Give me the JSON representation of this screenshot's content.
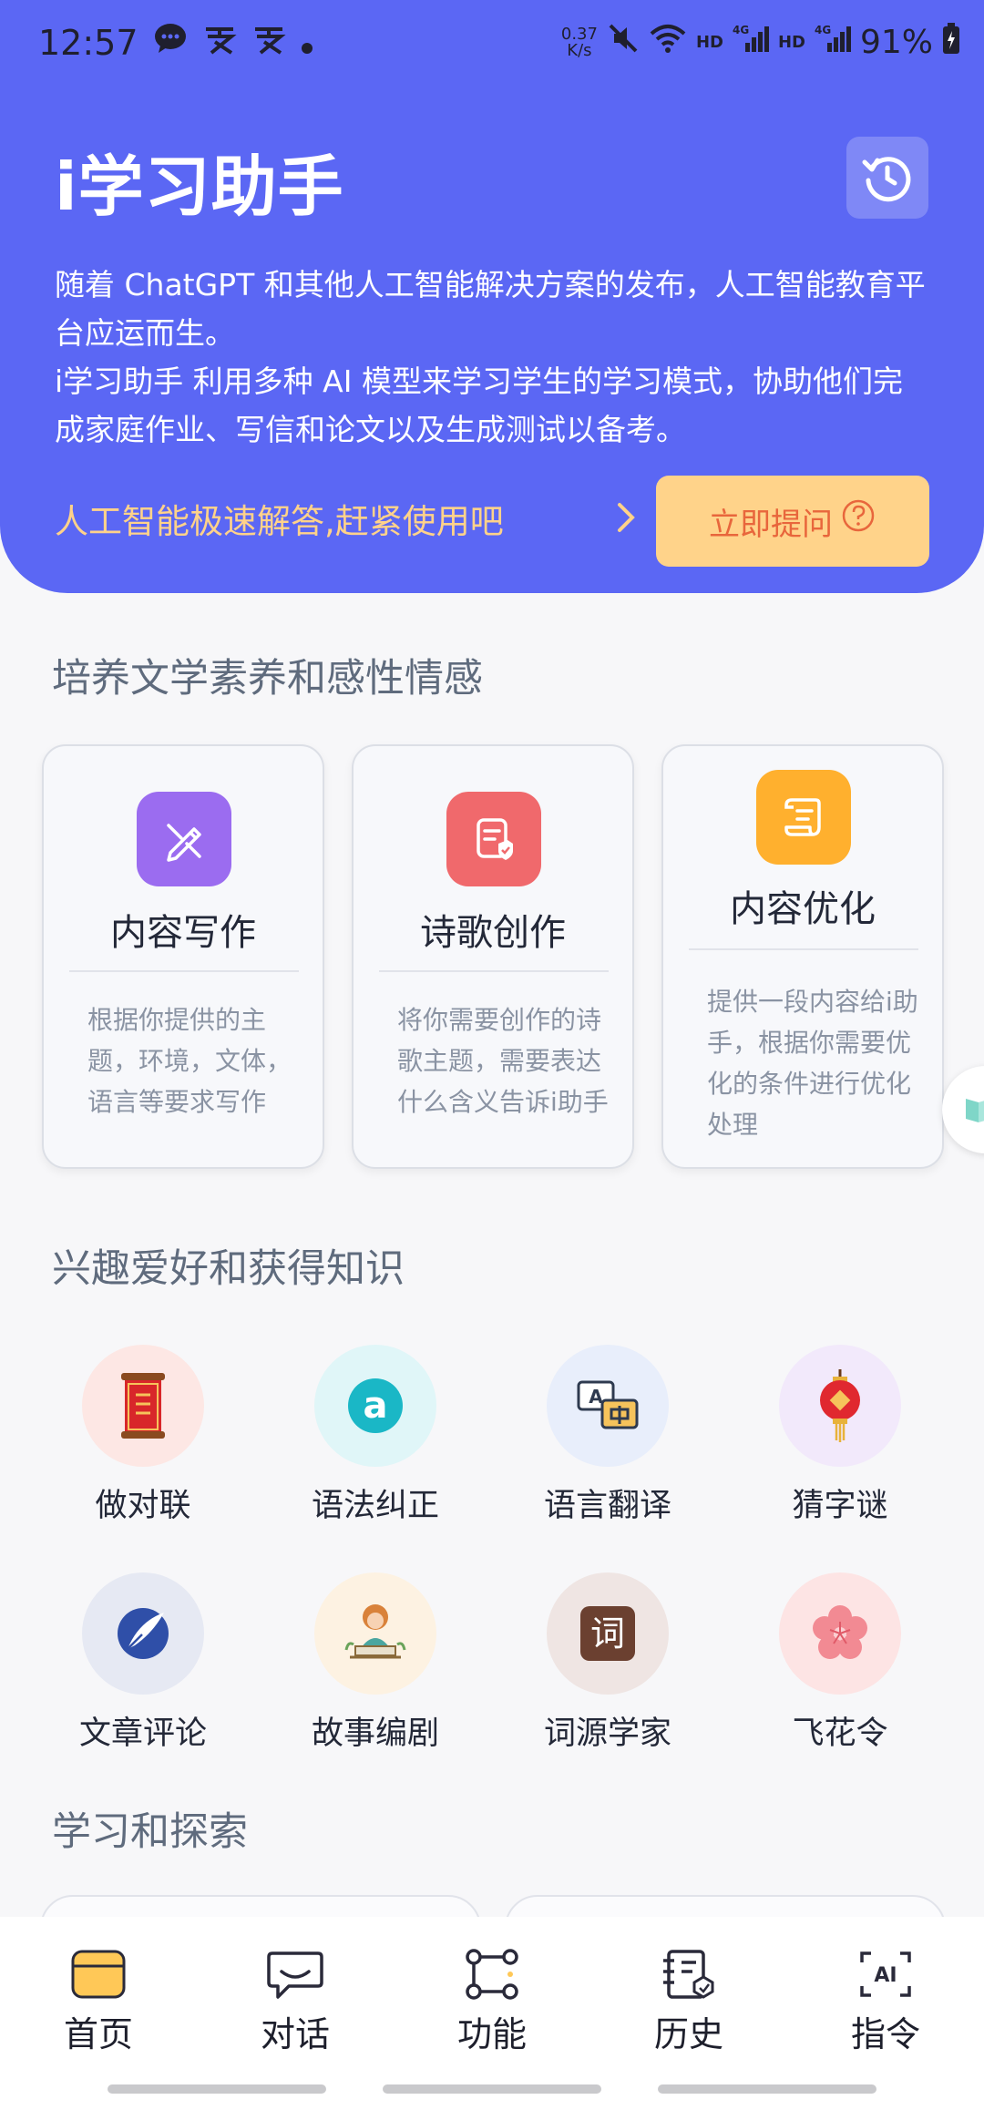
{
  "status_bar": {
    "time": "12:57",
    "net_speed_value": "0.37",
    "net_speed_unit": "K/s",
    "hd1": "HD",
    "hd2": "HD",
    "sig1": "4G",
    "sig2": "4G",
    "battery": "91%"
  },
  "header": {
    "title": "i学习助手",
    "intro_line1": "随着 ChatGPT 和其他人工智能解决方案的发布，人工智能教育平台应运而生。",
    "intro_line2": " i学习助手 利用多种 AI 模型来学习学生的学习模式，协助他们完成家庭作业、写信和论文以及生成测试以备考。",
    "cta_text": "人工智能极速解答,赶紧使用吧",
    "ask_button": "立即提问"
  },
  "section1": {
    "title": "培养文学素养和感性情感",
    "cards": [
      {
        "title": "内容写作",
        "desc": "根据你提供的主题，环境，文体，语言等要求写作",
        "icon": "pen-icon",
        "color": "#9b6cf0"
      },
      {
        "title": "诗歌创作",
        "desc": "将你需要创作的诗歌主题，需要表达什么含义告诉i助手",
        "icon": "poem-doc-icon",
        "color": "#f0696c"
      },
      {
        "title": "内容优化",
        "desc": "提供一段内容给i助手，根据你需要优化的条件进行优化处理",
        "icon": "scroll-icon",
        "color": "#ffb02e"
      }
    ]
  },
  "section2": {
    "title": "兴趣爱好和获得知识",
    "items": [
      {
        "label": "做对联",
        "icon": "couplet-scroll-icon",
        "bg": "#fde7e4"
      },
      {
        "label": "语法纠正",
        "icon": "grammar-a-icon",
        "bg": "#e0f6f8"
      },
      {
        "label": "语言翻译",
        "icon": "translate-icon",
        "bg": "#e8eefb"
      },
      {
        "label": "猜字谜",
        "icon": "lantern-icon",
        "bg": "#f2e9fb"
      },
      {
        "label": "文章评论",
        "icon": "quill-icon",
        "bg": "#e6e9f3"
      },
      {
        "label": "故事编剧",
        "icon": "storyteller-icon",
        "bg": "#fdf2e2"
      },
      {
        "label": "词源学家",
        "icon": "ci-char-icon",
        "bg": "#efe5e3"
      },
      {
        "label": "飞花令",
        "icon": "flower-icon",
        "bg": "#fde4e4"
      }
    ],
    "ci_char": "词"
  },
  "section3": {
    "title": "学习和探索"
  },
  "bottom_nav": [
    {
      "label": "首页",
      "icon": "home-icon"
    },
    {
      "label": "对话",
      "icon": "chat-icon"
    },
    {
      "label": "功能",
      "icon": "function-nodes-icon"
    },
    {
      "label": "历史",
      "icon": "history-book-icon"
    },
    {
      "label": "指令",
      "icon": "ai-command-icon"
    }
  ],
  "ai_badge": "AI"
}
